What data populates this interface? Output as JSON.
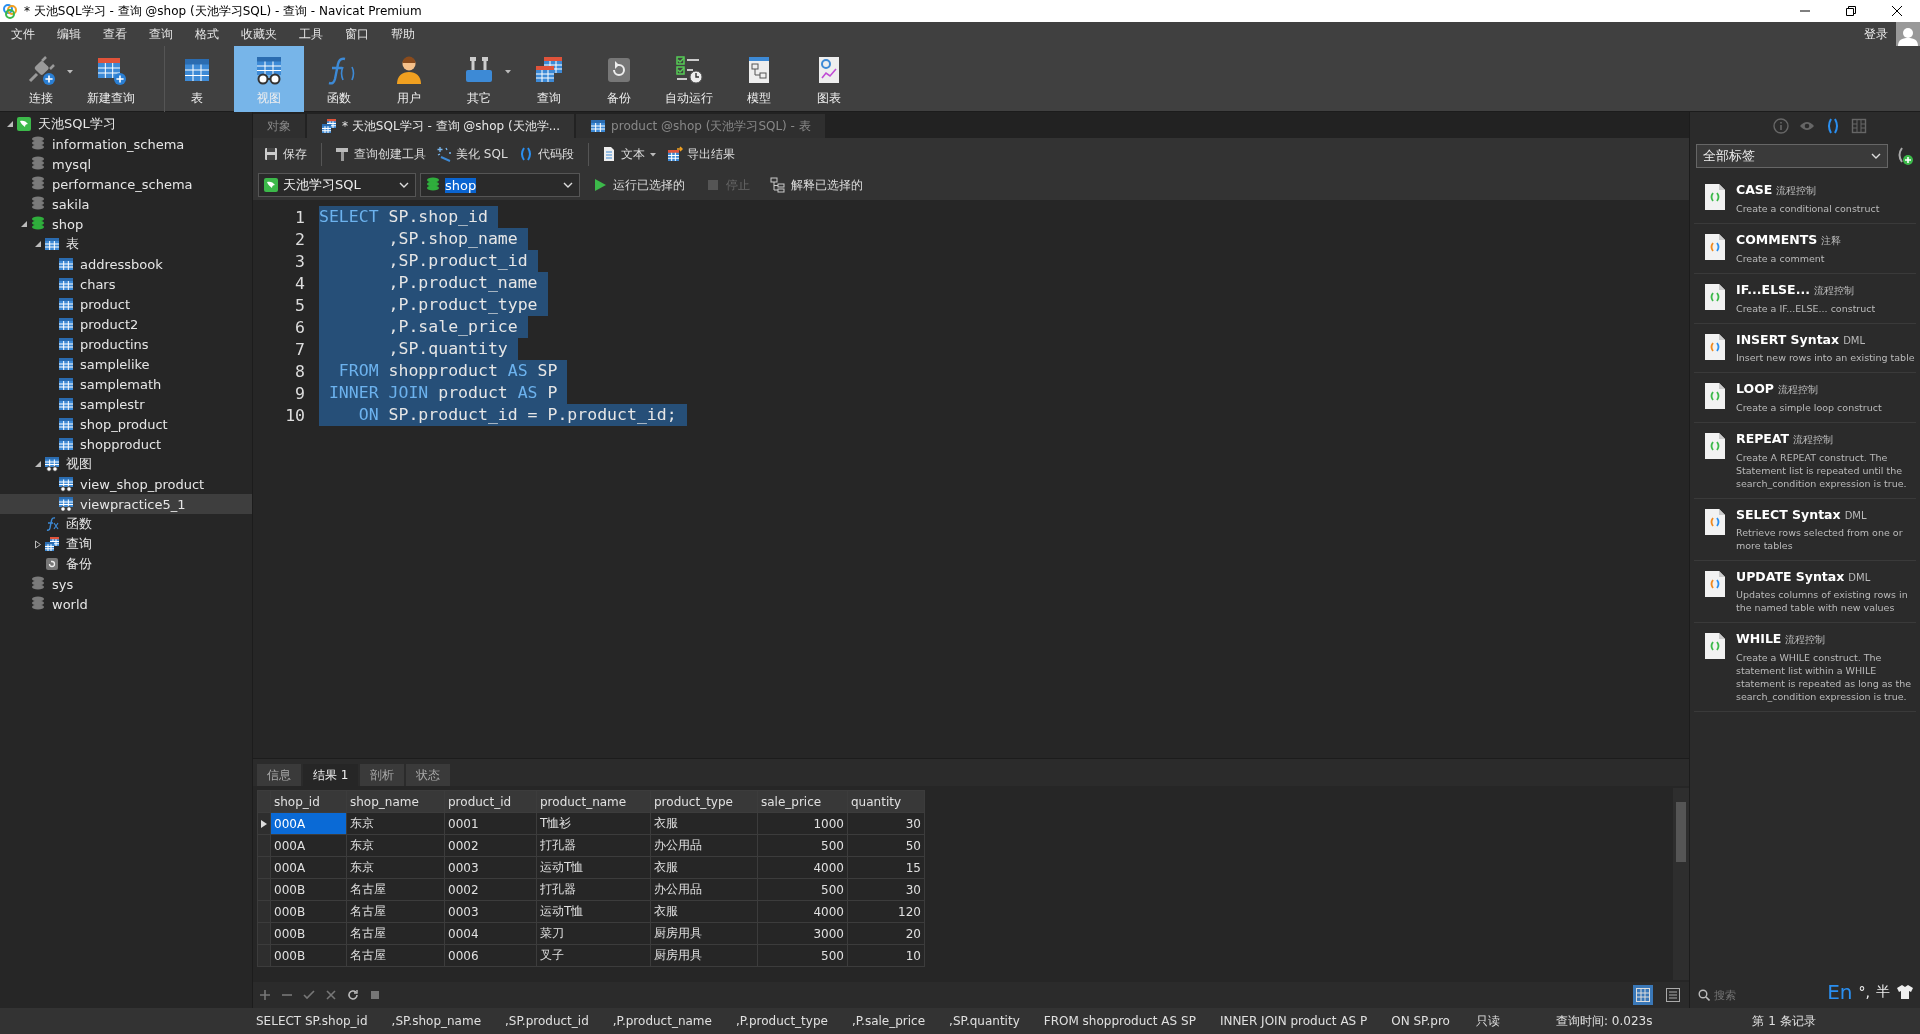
{
  "window": {
    "title": "* 天池SQL学习 - 查询 @shop (天池学习SQL) - 查询 - Navicat Premium"
  },
  "menu": [
    "文件",
    "编辑",
    "查看",
    "查询",
    "格式",
    "收藏夹",
    "工具",
    "窗口",
    "帮助"
  ],
  "account": {
    "login": "登录"
  },
  "toolbar": [
    {
      "label": "连接",
      "kind": "connect",
      "selected": false,
      "has_menu": true,
      "separator_before": false
    },
    {
      "label": "新建查询",
      "kind": "new-query",
      "selected": false,
      "has_menu": false,
      "separator_before": false
    },
    {
      "label": "表",
      "kind": "table",
      "selected": false,
      "has_menu": false,
      "separator_before": true
    },
    {
      "label": "视图",
      "kind": "view",
      "selected": true,
      "has_menu": false,
      "separator_before": false
    },
    {
      "label": "函数",
      "kind": "function",
      "selected": false,
      "has_menu": false,
      "separator_before": false
    },
    {
      "label": "用户",
      "kind": "user",
      "selected": false,
      "has_menu": false,
      "separator_before": false
    },
    {
      "label": "其它",
      "kind": "other",
      "selected": false,
      "has_menu": true,
      "separator_before": false
    },
    {
      "label": "查询",
      "kind": "query",
      "selected": false,
      "has_menu": false,
      "separator_before": false
    },
    {
      "label": "备份",
      "kind": "backup",
      "selected": false,
      "has_menu": false,
      "separator_before": false
    },
    {
      "label": "自动运行",
      "kind": "autorun",
      "selected": false,
      "has_menu": false,
      "separator_before": false
    },
    {
      "label": "模型",
      "kind": "model",
      "selected": false,
      "has_menu": false,
      "separator_before": false
    },
    {
      "label": "图表",
      "kind": "chart",
      "selected": false,
      "has_menu": false,
      "separator_before": false
    }
  ],
  "navigator": [
    {
      "label": "天池SQL学习",
      "kind": "connection",
      "expanded": true,
      "selected": false,
      "children": [
        {
          "label": "information_schema",
          "kind": "database",
          "open": false,
          "selected": false
        },
        {
          "label": "mysql",
          "kind": "database",
          "open": false,
          "selected": false
        },
        {
          "label": "performance_schema",
          "kind": "database",
          "open": false,
          "selected": false
        },
        {
          "label": "sakila",
          "kind": "database",
          "open": false,
          "selected": false
        },
        {
          "label": "shop",
          "kind": "database",
          "open": true,
          "expanded": true,
          "selected": false,
          "children": [
            {
              "label": "表",
              "kind": "tables",
              "expanded": true,
              "selected": false,
              "children": [
                {
                  "label": "addressbook",
                  "kind": "table",
                  "selected": false
                },
                {
                  "label": "chars",
                  "kind": "table",
                  "selected": false
                },
                {
                  "label": "product",
                  "kind": "table",
                  "selected": false
                },
                {
                  "label": "product2",
                  "kind": "table",
                  "selected": false
                },
                {
                  "label": "productins",
                  "kind": "table",
                  "selected": false
                },
                {
                  "label": "samplelike",
                  "kind": "table",
                  "selected": false
                },
                {
                  "label": "samplemath",
                  "kind": "table",
                  "selected": false
                },
                {
                  "label": "samplestr",
                  "kind": "table",
                  "selected": false
                },
                {
                  "label": "shop_product",
                  "kind": "table",
                  "selected": false
                },
                {
                  "label": "shopproduct",
                  "kind": "table",
                  "selected": false
                }
              ]
            },
            {
              "label": "视图",
              "kind": "views",
              "expanded": true,
              "selected": false,
              "children": [
                {
                  "label": "view_shop_product",
                  "kind": "view",
                  "selected": false
                },
                {
                  "label": "viewpractice5_1",
                  "kind": "view",
                  "selected": true
                }
              ]
            },
            {
              "label": "函数",
              "kind": "functions",
              "selected": false
            },
            {
              "label": "查询",
              "kind": "queries",
              "expanded": false,
              "selected": false
            },
            {
              "label": "备份",
              "kind": "backups",
              "selected": false
            }
          ]
        },
        {
          "label": "sys",
          "kind": "database",
          "open": false,
          "selected": false
        },
        {
          "label": "world",
          "kind": "database",
          "open": false,
          "selected": false
        }
      ]
    }
  ],
  "tabs": [
    {
      "label": "对象",
      "kind": "objects",
      "selected": false
    },
    {
      "label": "* 天池SQL学习 - 查询 @shop (天池学...",
      "kind": "query",
      "selected": true
    },
    {
      "label": "product @shop (天池学习SQL) - 表",
      "kind": "table",
      "selected": false
    }
  ],
  "query_toolbar": [
    {
      "label": "保存",
      "kind": "save",
      "has_menu": false,
      "separator_before": false
    },
    {
      "label": "查询创建工具",
      "kind": "builder",
      "has_menu": false,
      "separator_before": true
    },
    {
      "label": "美化 SQL",
      "kind": "beautify",
      "has_menu": false,
      "separator_before": false
    },
    {
      "label": "代码段",
      "kind": "snippet",
      "has_menu": false,
      "separator_before": false
    },
    {
      "label": "文本",
      "kind": "text",
      "has_menu": true,
      "separator_before": true
    },
    {
      "label": "导出结果",
      "kind": "export",
      "has_menu": false,
      "separator_before": false
    }
  ],
  "connection_bar": {
    "connection": "天池学习SQL",
    "database": {
      "value": "shop",
      "highlighted": true
    },
    "actions": [
      {
        "label": "运行已选择的",
        "kind": "run",
        "disabled": false
      },
      {
        "label": "停止",
        "kind": "stop",
        "disabled": true
      },
      {
        "label": "解释已选择的",
        "kind": "explain",
        "disabled": false
      }
    ]
  },
  "editor": {
    "lines": [
      {
        "number": "1",
        "selected": true,
        "segments": [
          {
            "kind": "keyword",
            "text": "SELECT"
          },
          {
            "kind": "plain",
            "text": " SP.shop_id"
          }
        ]
      },
      {
        "number": "2",
        "selected": true,
        "segments": [
          {
            "kind": "plain",
            "text": "       ,SP.shop_name"
          }
        ]
      },
      {
        "number": "3",
        "selected": true,
        "segments": [
          {
            "kind": "plain",
            "text": "       ,SP.product_id"
          }
        ]
      },
      {
        "number": "4",
        "selected": true,
        "segments": [
          {
            "kind": "plain",
            "text": "       ,P.product_name"
          }
        ]
      },
      {
        "number": "5",
        "selected": true,
        "segments": [
          {
            "kind": "plain",
            "text": "       ,P.product_type"
          }
        ]
      },
      {
        "number": "6",
        "selected": true,
        "segments": [
          {
            "kind": "plain",
            "text": "       ,P.sale_price"
          }
        ]
      },
      {
        "number": "7",
        "selected": true,
        "segments": [
          {
            "kind": "plain",
            "text": "       ,SP.quantity"
          }
        ]
      },
      {
        "number": "8",
        "selected": true,
        "segments": [
          {
            "kind": "keyword",
            "text": "  FROM"
          },
          {
            "kind": "plain",
            "text": " shopproduct "
          },
          {
            "kind": "keyword",
            "text": "AS"
          },
          {
            "kind": "plain",
            "text": " SP"
          }
        ]
      },
      {
        "number": "9",
        "selected": true,
        "segments": [
          {
            "kind": "keyword",
            "text": " INNER JOIN"
          },
          {
            "kind": "plain",
            "text": " product "
          },
          {
            "kind": "keyword",
            "text": "AS"
          },
          {
            "kind": "plain",
            "text": " P"
          }
        ]
      },
      {
        "number": "10",
        "selected": true,
        "segments": [
          {
            "kind": "keyword",
            "text": "    ON"
          },
          {
            "kind": "plain",
            "text": " SP.product_id = P.product_id;"
          }
        ]
      }
    ]
  },
  "result_tabs": [
    {
      "label": "信息",
      "selected": false
    },
    {
      "label": "结果 1",
      "selected": true
    },
    {
      "label": "剖析",
      "selected": false
    },
    {
      "label": "状态",
      "selected": false
    }
  ],
  "results": {
    "columns": [
      {
        "name": "shop_id",
        "kind": "text"
      },
      {
        "name": "shop_name",
        "kind": "text"
      },
      {
        "name": "product_id",
        "kind": "text"
      },
      {
        "name": "product_name",
        "kind": "text"
      },
      {
        "name": "product_type",
        "kind": "text"
      },
      {
        "name": "sale_price",
        "kind": "number"
      },
      {
        "name": "quantity",
        "kind": "number"
      }
    ],
    "rows": [
      {
        "selected": true,
        "cells": [
          "000A",
          "东京",
          "0001",
          "T恤衫",
          "衣服",
          "1000",
          "30"
        ]
      },
      {
        "selected": false,
        "cells": [
          "000A",
          "东京",
          "0002",
          "打孔器",
          "办公用品",
          "500",
          "50"
        ]
      },
      {
        "selected": false,
        "cells": [
          "000A",
          "东京",
          "0003",
          "运动T恤",
          "衣服",
          "4000",
          "15"
        ]
      },
      {
        "selected": false,
        "cells": [
          "000B",
          "名古屋",
          "0002",
          "打孔器",
          "办公用品",
          "500",
          "30"
        ]
      },
      {
        "selected": false,
        "cells": [
          "000B",
          "名古屋",
          "0003",
          "运动T恤",
          "衣服",
          "4000",
          "120"
        ]
      },
      {
        "selected": false,
        "cells": [
          "000B",
          "名古屋",
          "0004",
          "菜刀",
          "厨房用具",
          "3000",
          "20"
        ]
      },
      {
        "selected": false,
        "cells": [
          "000B",
          "名古屋",
          "0006",
          "叉子",
          "厨房用具",
          "500",
          "10"
        ]
      }
    ]
  },
  "view_modes": [
    {
      "kind": "grid",
      "selected": true
    },
    {
      "kind": "form",
      "selected": false
    }
  ],
  "panel": {
    "tabs": [
      {
        "kind": "info",
        "selected": false
      },
      {
        "kind": "preview",
        "selected": false
      },
      {
        "kind": "snippets",
        "selected": true
      },
      {
        "kind": "layout",
        "selected": false
      }
    ],
    "filter": "全部标签",
    "snippets": [
      {
        "title": "CASE",
        "tag": "流程控制",
        "kind": "flow",
        "description": "Create a conditional construct"
      },
      {
        "title": "COMMENTS",
        "tag": "注释",
        "kind": "comment",
        "description": "Create a comment"
      },
      {
        "title": "IF...ELSE...",
        "tag": "流程控制",
        "kind": "flow",
        "description": "Create a IF...ELSE... construct"
      },
      {
        "title": "INSERT Syntax",
        "tag": "DML",
        "kind": "dml",
        "description": "Insert new rows into an existing table"
      },
      {
        "title": "LOOP",
        "tag": "流程控制",
        "kind": "flow",
        "description": "Create a simple loop construct"
      },
      {
        "title": "REPEAT",
        "tag": "流程控制",
        "kind": "flow",
        "description": "Create A REPEAT construct. The Statement list is repeated until the search_condition expression is true."
      },
      {
        "title": "SELECT Syntax",
        "tag": "DML",
        "kind": "dml",
        "description": "Retrieve rows selected from one or more tables"
      },
      {
        "title": "UPDATE Syntax",
        "tag": "DML",
        "kind": "dml",
        "description": "Updates columns of existing rows in the named table with new values"
      },
      {
        "title": "WHILE",
        "tag": "流程控制",
        "kind": "flow",
        "description": "Create a WHILE construct. The statement list within a WHILE statement is repeated as long as the search_condition expression is true."
      }
    ],
    "search": {
      "placeholder": "搜索"
    }
  },
  "status_bar": {
    "sql": [
      "SELECT SP.shop_id",
      ",SP.shop_name",
      ",SP.product_id",
      ",P.product_name",
      ",P.product_type",
      ",P.sale_price",
      ",SP.quantity",
      "FROM shopproduct AS SP",
      "INNER JOIN product AS P",
      "ON SP.pro"
    ],
    "mode": "只读",
    "query_time": "查询时间: 0.023s",
    "record": "第 1 条记录"
  },
  "ime": {
    "mode": "En",
    "punctuation": "°,",
    "width": "半"
  }
}
